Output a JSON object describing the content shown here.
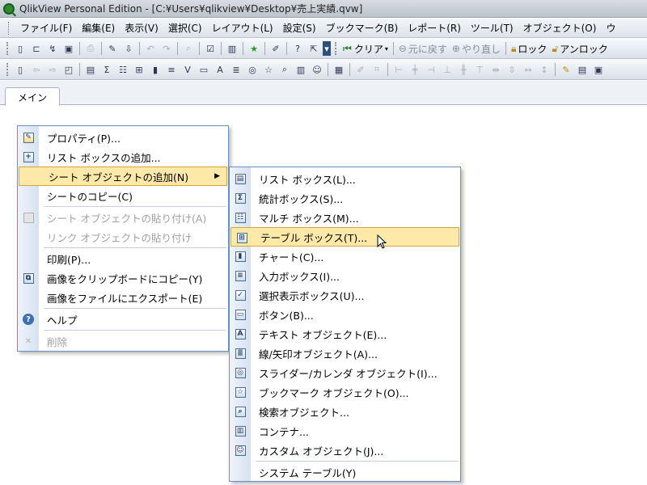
{
  "window": {
    "title": "QlikView Personal Edition - [C:¥Users¥qlikview¥Desktop¥売上実績.qvw]"
  },
  "menubar": {
    "items": [
      "ファイル(F)",
      "編集(E)",
      "表示(V)",
      "選択(C)",
      "レイアウト(L)",
      "設定(S)",
      "ブックマーク(B)",
      "レポート(R)",
      "ツール(T)",
      "オブジェクト(O)",
      "ウ"
    ]
  },
  "toolbar": {
    "clear_label": "クリア",
    "back_label": "元に戻す",
    "forward_label": "やり直し",
    "lock_label": "ロック",
    "unlock_label": "アンロック"
  },
  "tabs": {
    "active": "メイン"
  },
  "context_menu": {
    "properties": "プロパティ(P)...",
    "add_listbox": "リスト ボックスの追加...",
    "add_sheet_object": "シート オブジェクトの追加(N)",
    "copy_sheet": "シートのコピー(C)",
    "paste_sheet_object": "シート オブジェクトの貼り付け(A)",
    "paste_link_object": "リンク オブジェクトの貼り付け",
    "print": "印刷(P)...",
    "copy_image_clipboard": "画像をクリップボードにコピー(Y)",
    "export_image_file": "画像をファイルにエクスポート(E)",
    "help": "ヘルプ",
    "delete": "削除"
  },
  "submenu": {
    "list_box": "リスト ボックス(L)...",
    "statistics_box": "統計ボックス(S)...",
    "multi_box": "マルチ ボックス(M)...",
    "table_box": "テーブル ボックス(T)...",
    "chart": "チャート(C)...",
    "input_box": "入力ボックス(I)...",
    "current_selections_box": "選択表示ボックス(U)...",
    "button": "ボタン(B)...",
    "text_object": "テキスト オブジェクト(E)...",
    "line_arrow_object": "線/矢印オブジェクト(A)...",
    "slider_calendar_object": "スライダー/カレンダ オブジェクト(I)...",
    "bookmark_object": "ブックマーク オブジェクト(O)...",
    "search_object": "検索オブジェクト...",
    "container": "コンテナ...",
    "custom_object": "カスタム オブジェクト(J)...",
    "system_table": "システム テーブル(Y)"
  },
  "colors": {
    "highlight": "#ffe9a8",
    "menu_border": "#6e8fc0",
    "gutter": "#dbe6f4"
  }
}
